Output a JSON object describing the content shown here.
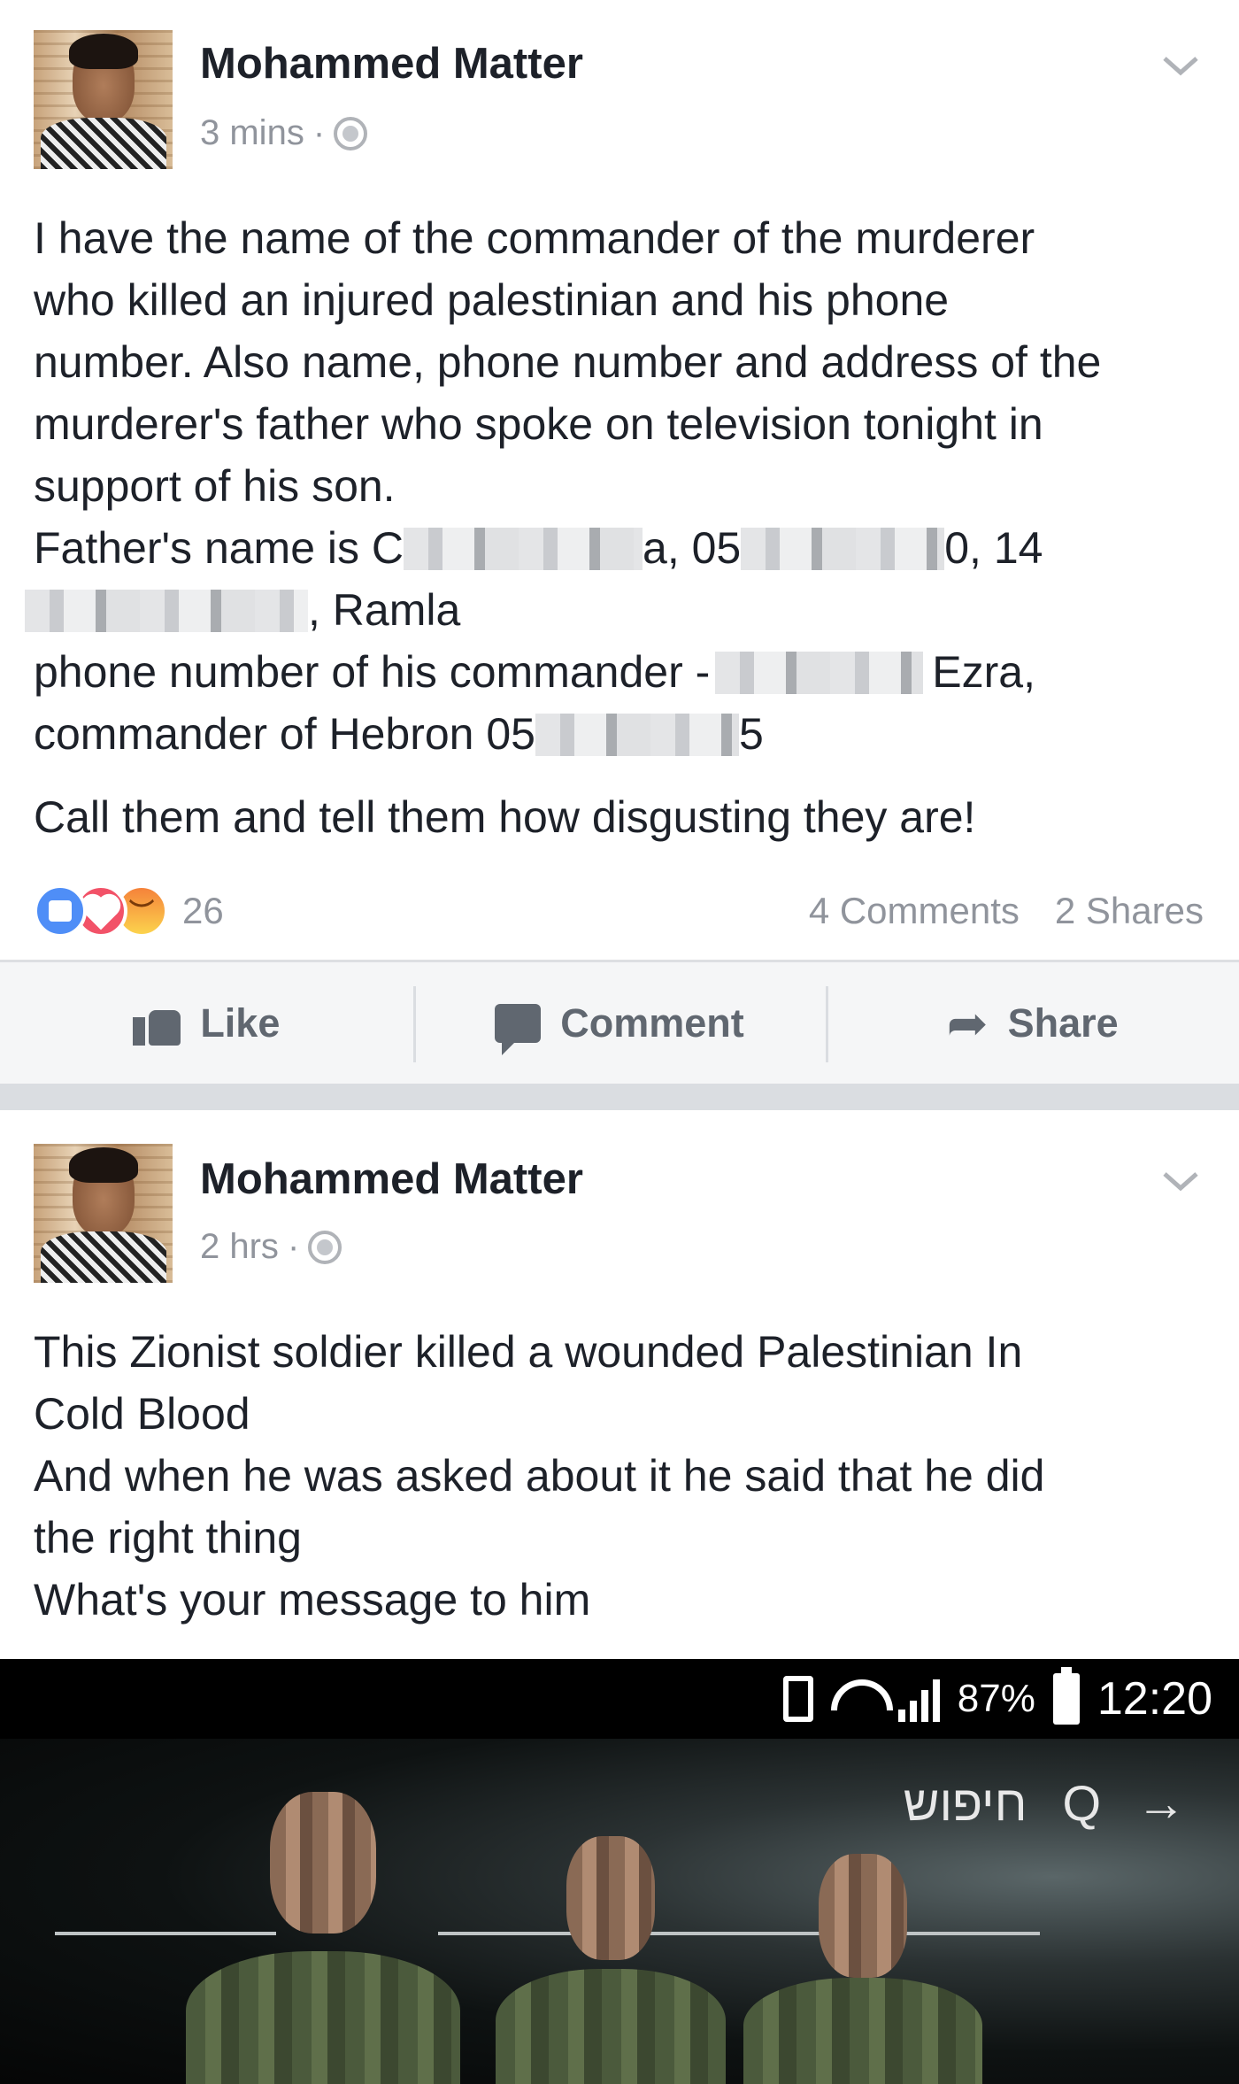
{
  "post1": {
    "author": "Mohammed Matter",
    "time": "3 mins",
    "sep": "·",
    "text_lines": [
      "I have the name of the commander of the murderer",
      "who killed an injured palestinian and his phone",
      "number. Also name, phone number and address of the",
      "murderer's father who spoke on television tonight in",
      "support of his son."
    ],
    "father_prefix": "Father's name is C",
    "father_mid": "a, 05",
    "father_end": "0, 14",
    "address_end": ", Ramla",
    "commander_prefix": "phone number of his commander -",
    "commander_end": "Ezra,",
    "hebron_prefix": "commander of Hebron 05",
    "hebron_end": "5",
    "call_line": "Call them and tell them how disgusting they are!",
    "reaction_count": "26",
    "comments": "4 Comments",
    "shares": "2 Shares",
    "actions": {
      "like": "Like",
      "comment": "Comment",
      "share": "Share"
    }
  },
  "post2": {
    "author": "Mohammed Matter",
    "time": "2 hrs",
    "sep": "·",
    "text_lines": [
      "This Zionist soldier killed a wounded Palestinian In",
      "Cold Blood",
      "And when he was asked about it he said that he did",
      "the right thing",
      "What's your message to him"
    ],
    "video": {
      "battery": "87%",
      "time": "12:20",
      "search_label": "חיפוש",
      "search_icon": "Q",
      "arrow": "→"
    }
  },
  "icons": {
    "chevron": "chevron-down-icon",
    "globe": "globe-icon",
    "like": "thumbs-up-icon",
    "comment": "comment-bubble-icon",
    "share": "share-arrow-icon"
  }
}
